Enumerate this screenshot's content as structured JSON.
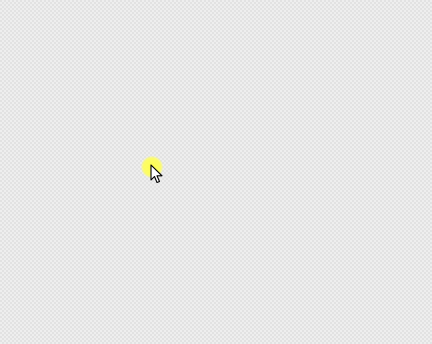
{
  "desktop": {
    "background_color": "#eeeeee",
    "pattern_color": "#d8d8d8"
  },
  "pointer": {
    "icon": "arrow-cursor-icon",
    "highlight_color": "#ffff46"
  }
}
